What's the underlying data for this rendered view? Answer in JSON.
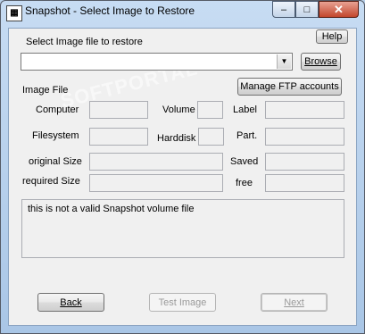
{
  "window": {
    "title": "Snapshot - Select Image to Restore",
    "minimize_glyph": "–",
    "maximize_glyph": "□",
    "close_glyph": "✕"
  },
  "help_label": "Help",
  "select_image_label": "Select Image file to restore",
  "image_path_value": "",
  "browse_label": "Browse",
  "manage_ftp_label": "Manage FTP accounts",
  "image_file_label": "Image File",
  "fields": {
    "computer_label": "Computer",
    "volume_label": "Volume",
    "label_label": "Label",
    "filesystem_label": "Filesystem",
    "harddisk_label": "Harddisk",
    "part_label": "Part.",
    "original_size_label": "original Size",
    "saved_label": "Saved",
    "required_size_label": "required Size",
    "free_label": "free"
  },
  "status_message": "this is not a valid Snapshot volume file",
  "buttons": {
    "back": "Back",
    "test_image": "Test Image",
    "next": "Next"
  },
  "watermark": "SOFTPORTAL"
}
